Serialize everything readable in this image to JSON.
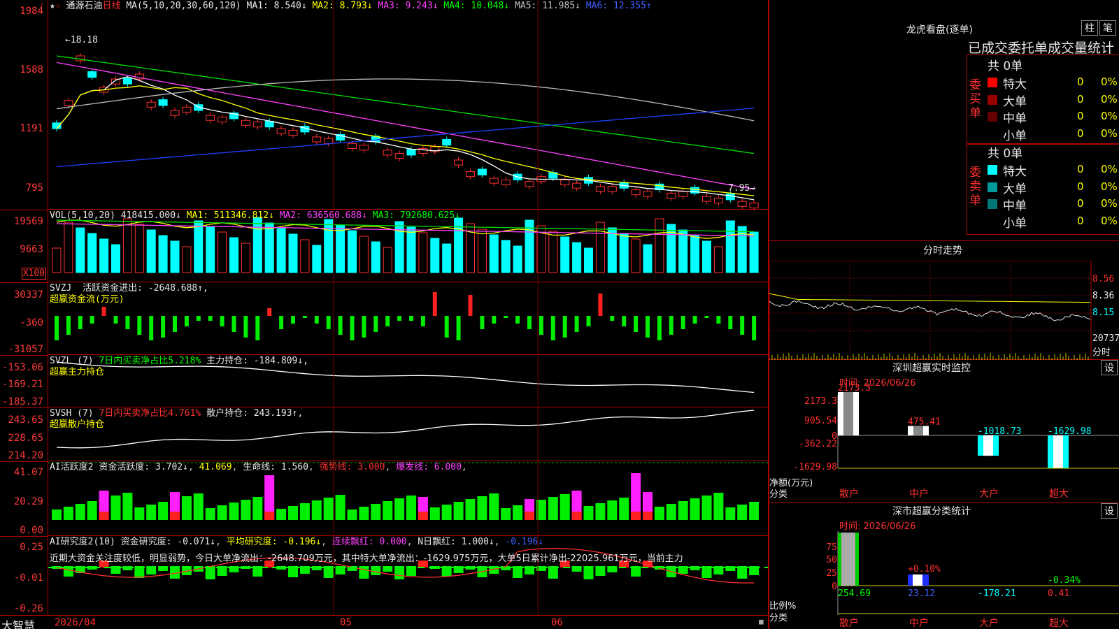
{
  "stock": {
    "name": "通源石油",
    "period": "日线",
    "ma_params": "MA(5,10,20,30,60,120)",
    "ma1": "MA1: 8.540↓",
    "ma2": "MA2: 8.793↓",
    "ma3": "MA3: 9.243↓",
    "ma4": "MA4: 10.048↓",
    "ma5": "MA5: 11.985↓",
    "ma6": "MA6: 12.355↑",
    "high_mark": "18.18",
    "low_mark": "7.95",
    "axis": [
      "1984",
      "1588",
      "1191",
      "795"
    ]
  },
  "vol": {
    "label": "VOL(5,10,20)",
    "value": "418415.000↓",
    "ma1": "MA1: 511346.812↓",
    "ma2": "MA2: 636560.688↓",
    "ma3": "MA3: 792680.625↓",
    "axis": [
      "19569",
      "9663"
    ],
    "unit": "X100"
  },
  "svzj": {
    "label": "SVZJ",
    "text": "活跃资金进出: -2648.688↑,",
    "sub": "超赢资金流(万元)",
    "axis": [
      "30337",
      "-360",
      "-31057"
    ]
  },
  "svzl": {
    "label": "SVZL (7)",
    "pct": "7日内买卖净占比5.218%",
    "text": "主力持仓: -184.809↓,",
    "sub": "超赢主力持仓",
    "axis": [
      "-153.06",
      "-169.21",
      "-185.37"
    ]
  },
  "svsh": {
    "label": "SVSH (7)",
    "pct": "7日内买卖净占比4.761%",
    "text": "散户持仓: 243.193↑,",
    "sub": "超赢散户持仓",
    "axis": [
      "243.65",
      "228.65",
      "214.20"
    ]
  },
  "ai1": {
    "label": "AI活跃度2",
    "text": "资金活跃度: 3.702↓",
    "v2": "41.069",
    "life": "生命线: 1.560",
    "strong": "强势线: 3.000",
    "burst": "爆发线: 6.000",
    "axis": [
      "41.07",
      "20.29",
      "0.00"
    ]
  },
  "ai2": {
    "label": "AI研究度2(10)",
    "text": "资金研究度: -0.071↓",
    "avg": "平均研究度: -0.196↓",
    "red1": "连续飘红: 0.000",
    "red2": "N日飘红: 1.000↓",
    "v": "-0.196↓",
    "comment": "近期大资金关注度较低，明显弱势，今日大单净流出：-2648.709万元，其中特大单净流出：-1629.975万元，大单5日累计净出-22025.961万元，当前主力",
    "axis": [
      "0.25",
      "-0.01",
      "-0.26"
    ]
  },
  "bottom": {
    "brand": "大智慧",
    "date": "2026/04",
    "m1": "05",
    "m2": "06"
  },
  "lhb": {
    "title": "龙虎看盘(逐单)",
    "btn1": "柱",
    "btn2": "笔",
    "section_title": "已成交委托单成交量统计",
    "buy_label": "委买单",
    "sell_label": "委卖单",
    "buy_total": "共 0单",
    "sell_total": "共 0单",
    "rows": [
      {
        "name": "特大",
        "v": "0",
        "p": "0%"
      },
      {
        "name": "大单",
        "v": "0",
        "p": "0%"
      },
      {
        "name": "中单",
        "v": "0",
        "p": "0%"
      },
      {
        "name": "小单",
        "v": "0",
        "p": "0%"
      }
    ],
    "buy_colors": [
      "#ff0000",
      "#990000",
      "#660000",
      "#000000"
    ],
    "sell_colors": [
      "#00ffff",
      "#009999",
      "#007777",
      "#000000"
    ]
  },
  "fenshi": {
    "title": "分时走势",
    "axis": [
      "8.56",
      "8.36",
      "8.15",
      "20737"
    ],
    "unit": "分时"
  },
  "monitor": {
    "title": "深圳超赢实时监控",
    "btn": "设",
    "date": "时间: 2026/06/26",
    "axis": [
      "2173.3",
      "905.54",
      "0",
      "-362.22",
      "-1629.98"
    ],
    "ylabel": "净额(万元)",
    "xlabel": "分类",
    "bars": [
      {
        "cat": "散户",
        "v": "2173.3"
      },
      {
        "cat": "中户",
        "v": "475.41"
      },
      {
        "cat": "大户",
        "v": "-1018.73"
      },
      {
        "cat": "超大",
        "v": "-1629.98"
      }
    ]
  },
  "classify": {
    "title": "深市超赢分类统计",
    "btn": "设",
    "date": "时间: 2026/06/26",
    "axis": [
      "75",
      "50",
      "25",
      "0"
    ],
    "ylabel": "比例%",
    "xlabel": "分类",
    "bars": [
      {
        "cat": "散户",
        "v": "254.69",
        "p": ""
      },
      {
        "cat": "中户",
        "v": "23.12",
        "p": "+0.10%"
      },
      {
        "cat": "大户",
        "v": "-178.21",
        "p": ""
      },
      {
        "cat": "超大",
        "v": "0.41",
        "p": "-0.34%"
      }
    ]
  }
}
